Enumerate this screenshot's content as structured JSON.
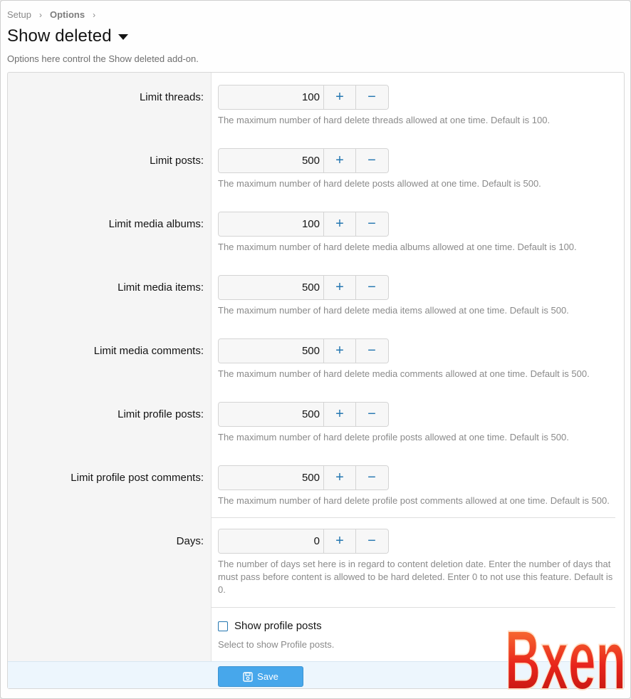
{
  "breadcrumb": {
    "items": [
      "Setup",
      "Options"
    ]
  },
  "header": {
    "title": "Show deleted",
    "description": "Options here control the Show deleted add-on."
  },
  "options": [
    {
      "label": "Limit threads:",
      "value": "100",
      "explain": "The maximum number of hard delete threads allowed at one time. Default is 100."
    },
    {
      "label": "Limit posts:",
      "value": "500",
      "explain": "The maximum number of hard delete posts allowed at one time. Default is 500."
    },
    {
      "label": "Limit media albums:",
      "value": "100",
      "explain": "The maximum number of hard delete media albums allowed at one time. Default is 100."
    },
    {
      "label": "Limit media items:",
      "value": "500",
      "explain": "The maximum number of hard delete media items allowed at one time. Default is 500."
    },
    {
      "label": "Limit media comments:",
      "value": "500",
      "explain": "The maximum number of hard delete media comments allowed at one time. Default is 500."
    },
    {
      "label": "Limit profile posts:",
      "value": "500",
      "explain": "The maximum number of hard delete profile posts allowed at one time. Default is 500."
    },
    {
      "label": "Limit profile post comments:",
      "value": "500",
      "explain": "The maximum number of hard delete profile post comments allowed at one time. Default is 500."
    },
    {
      "label": "Days:",
      "value": "0",
      "explain": "The number of days set here is in regard to content deletion date. Enter the number of days that must pass before content is allowed to be hard deleted. Enter 0 to not use this feature. Default is 0."
    }
  ],
  "spinner": {
    "plus": "+",
    "minus": "−"
  },
  "checkbox": {
    "label": "Show profile posts",
    "explain": "Select to show Profile posts.",
    "checked": false
  },
  "submit": {
    "save_label": "Save"
  },
  "watermark": {
    "text": "Bxen"
  },
  "colors": {
    "accent": "#2577b1",
    "save_button": "#47a7eb",
    "submit_bar": "#edf6fd",
    "logo": "#e8251b"
  },
  "icons": {
    "caret": "caret-down-icon",
    "save": "save-icon",
    "checkbox": "checkbox-icon"
  }
}
